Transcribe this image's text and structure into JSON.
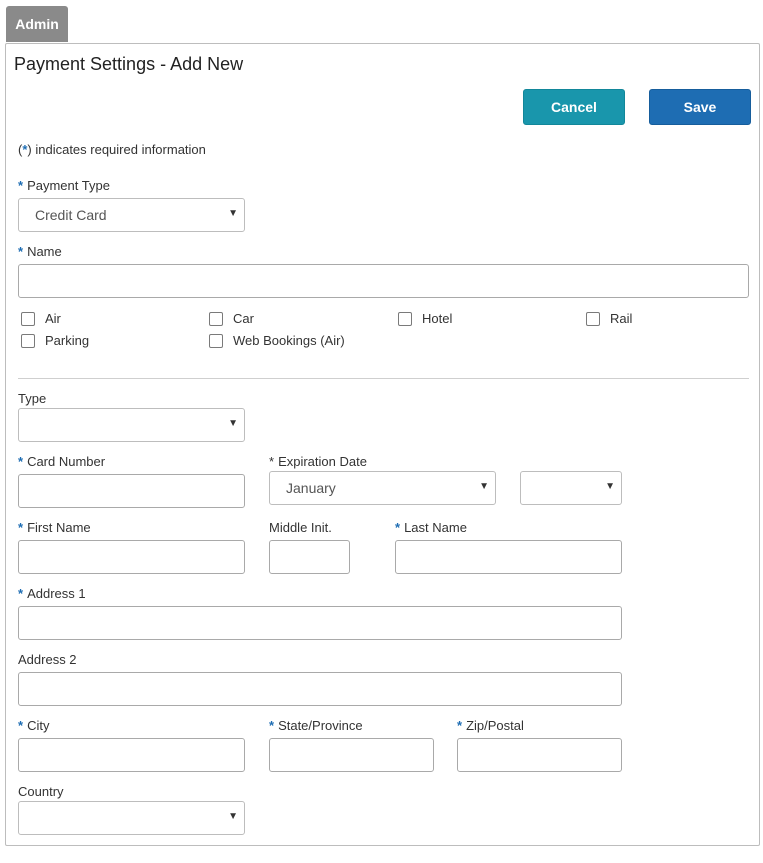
{
  "tab": {
    "label": "Admin"
  },
  "header": {
    "title": "Payment Settings - Add New"
  },
  "toolbar": {
    "cancel_label": "Cancel",
    "save_label": "Save"
  },
  "note": {
    "prefix": "(",
    "star": "*",
    "suffix": ") indicates required information"
  },
  "fields": {
    "payment_type": {
      "label": "Payment Type",
      "value": "Credit Card"
    },
    "name": {
      "label": "Name",
      "value": ""
    },
    "type": {
      "label": "Type",
      "value": ""
    },
    "card_number": {
      "label": "Card Number",
      "value": ""
    },
    "expiration": {
      "label": "Expiration Date",
      "month": "January",
      "year": ""
    },
    "first_name": {
      "label": "First Name"
    },
    "middle_init": {
      "label": "Middle Init."
    },
    "last_name": {
      "label": "Last Name"
    },
    "address1": {
      "label": "Address 1"
    },
    "address2": {
      "label": "Address 2"
    },
    "city": {
      "label": "City"
    },
    "state": {
      "label": "State/Province"
    },
    "zip": {
      "label": "Zip/Postal"
    },
    "country": {
      "label": "Country",
      "value": ""
    }
  },
  "checkboxes": {
    "air": "Air",
    "car": "Car",
    "hotel": "Hotel",
    "rail": "Rail",
    "parking": "Parking",
    "web": "Web Bookings (Air)"
  },
  "glyphs": {
    "star": "*",
    "caret": "▼"
  }
}
